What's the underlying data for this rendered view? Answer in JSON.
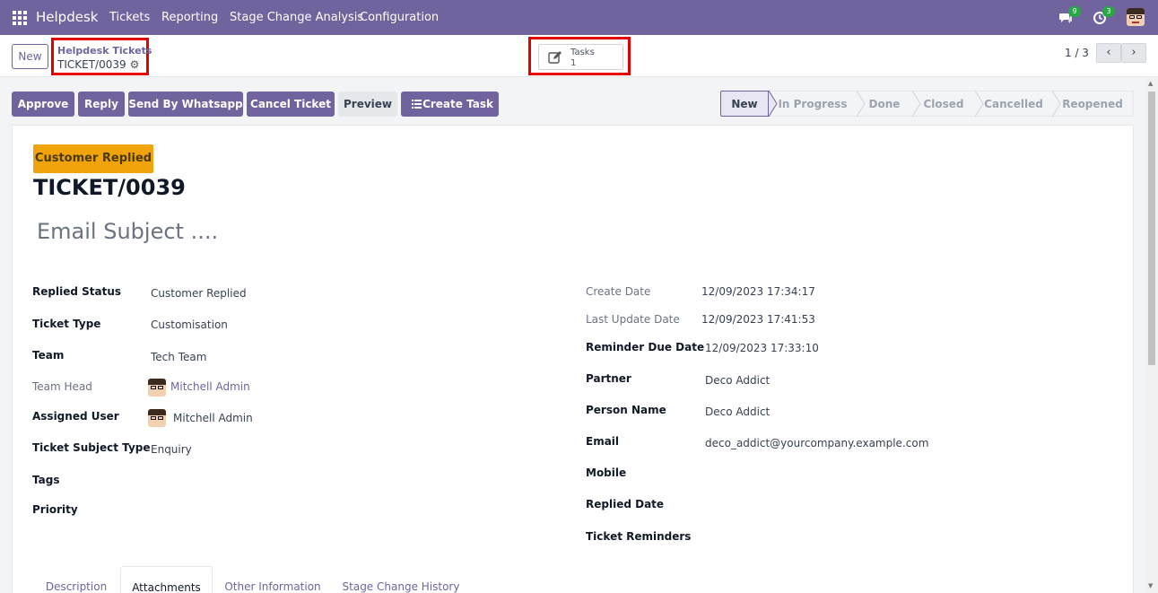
{
  "navbar": {
    "brand": "Helpdesk",
    "menu": [
      "Tickets",
      "Reporting",
      "Stage Change Analysis",
      "Configuration"
    ],
    "messages_count": "9",
    "activities_count": "3",
    "bg_color": "#71639e"
  },
  "control_panel": {
    "new_label": "New",
    "breadcrumb_parent": "Helpdesk Tickets",
    "breadcrumb_current": "TICKET/0039",
    "tasks_label": "Tasks",
    "tasks_count": "1",
    "pager": "1 / 3"
  },
  "actions": {
    "approve": "Approve",
    "reply": "Reply",
    "whatsapp": "Send By Whatsapp",
    "cancel": "Cancel Ticket",
    "preview": "Preview",
    "create_task": "Create Task"
  },
  "stages": [
    "New",
    "In Progress",
    "Done",
    "Closed",
    "Cancelled",
    "Reopened"
  ],
  "active_stage": "New",
  "sheet": {
    "ribbon": "Customer Replied",
    "ribbon_color": "#f0a30a",
    "title": "TICKET/0039",
    "subject_placeholder": "Email Subject ...."
  },
  "left_fields": {
    "replied_status": {
      "label": "Replied Status",
      "value": "Customer Replied"
    },
    "ticket_type": {
      "label": "Ticket Type",
      "value": "Customisation"
    },
    "team": {
      "label": "Team",
      "value": "Tech Team"
    },
    "team_head": {
      "label": "Team Head",
      "value": "Mitchell Admin"
    },
    "assigned_user": {
      "label": "Assigned User",
      "value": "Mitchell Admin"
    },
    "subject_type": {
      "label": "Ticket Subject Type",
      "value": "Enquiry"
    },
    "tags": {
      "label": "Tags",
      "value": ""
    },
    "priority": {
      "label": "Priority",
      "value": ""
    }
  },
  "right_fields": {
    "create_date": {
      "label": "Create Date",
      "value": "12/09/2023 17:34:17"
    },
    "last_update": {
      "label": "Last Update Date",
      "value": "12/09/2023 17:41:53"
    },
    "reminder_due": {
      "label": "Reminder Due Date",
      "value": "12/09/2023 17:33:10"
    },
    "partner": {
      "label": "Partner",
      "value": "Deco Addict"
    },
    "person_name": {
      "label": "Person Name",
      "value": "Deco Addict"
    },
    "email": {
      "label": "Email",
      "value": "deco_addict@yourcompany.example.com"
    },
    "mobile": {
      "label": "Mobile",
      "value": ""
    },
    "replied_date": {
      "label": "Replied Date",
      "value": ""
    },
    "ticket_reminders": {
      "label": "Ticket Reminders",
      "value": ""
    }
  },
  "tabs": [
    "Description",
    "Attachments",
    "Other Information",
    "Stage Change History"
  ],
  "active_tab": "Attachments"
}
